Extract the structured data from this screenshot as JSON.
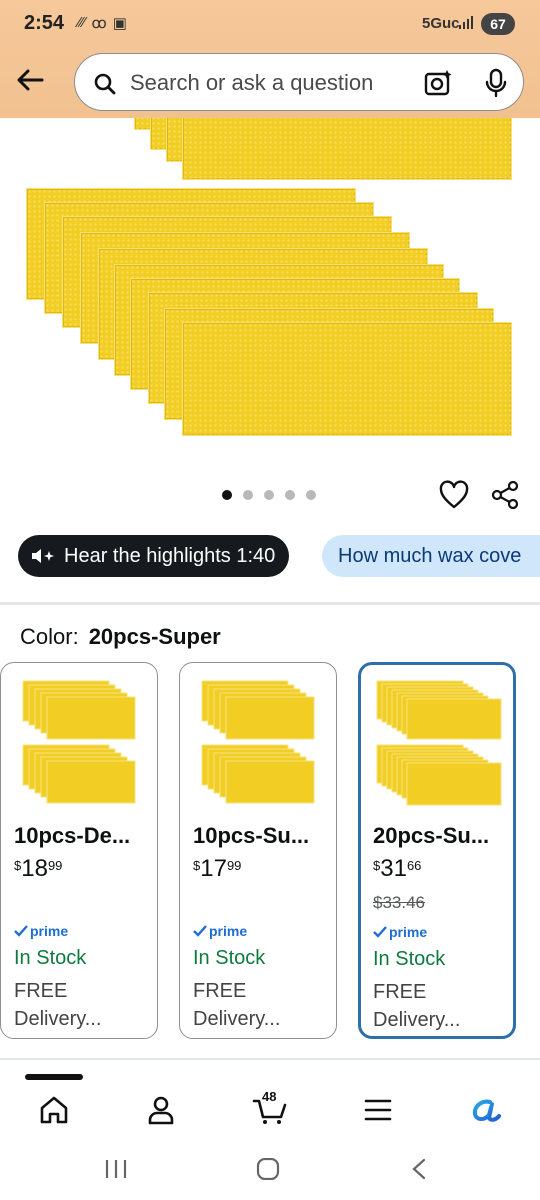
{
  "status_bar": {
    "time": "2:54",
    "network": "5Guc",
    "battery": "67"
  },
  "header": {
    "search_placeholder": "Search or ask a question",
    "icons": [
      "back-arrow-icon",
      "search-icon",
      "camera-lens-icon",
      "mic-icon"
    ]
  },
  "gallery": {
    "image_count": 5,
    "active_index": 0
  },
  "chips": {
    "hear_label": "Hear the highlights 1:40",
    "ask_label": "How much wax cove"
  },
  "color": {
    "label": "Color:",
    "value": "20pcs-Super"
  },
  "variants": [
    {
      "name": "10pcs-De...",
      "price_dollars": "18",
      "price_cents": "99",
      "currency": "$",
      "prime": "prime",
      "stock": "In Stock",
      "delivery": "FREE Delivery..."
    },
    {
      "name": "10pcs-Su...",
      "price_dollars": "17",
      "price_cents": "99",
      "currency": "$",
      "prime": "prime",
      "stock": "In Stock",
      "delivery": "FREE Delivery..."
    },
    {
      "name": "20pcs-Su...",
      "price_dollars": "31",
      "price_cents": "66",
      "currency": "$",
      "list_price": "$33.46",
      "prime": "prime",
      "stock": "In Stock",
      "delivery": "FREE Delivery...",
      "selected": true
    }
  ],
  "bottom_nav": {
    "cart_count": "48",
    "items": [
      "home-icon",
      "account-icon",
      "cart-icon",
      "menu-icon",
      "rufus-icon"
    ]
  },
  "colors": {
    "header_bg": "#f1c190",
    "wax_yellow": "#f2cd24",
    "selected_border": "#2e6fa7",
    "in_stock_green": "#0f7a3e",
    "prime_blue": "#1f6ed4",
    "ask_chip_bg": "#cfe6fb"
  }
}
